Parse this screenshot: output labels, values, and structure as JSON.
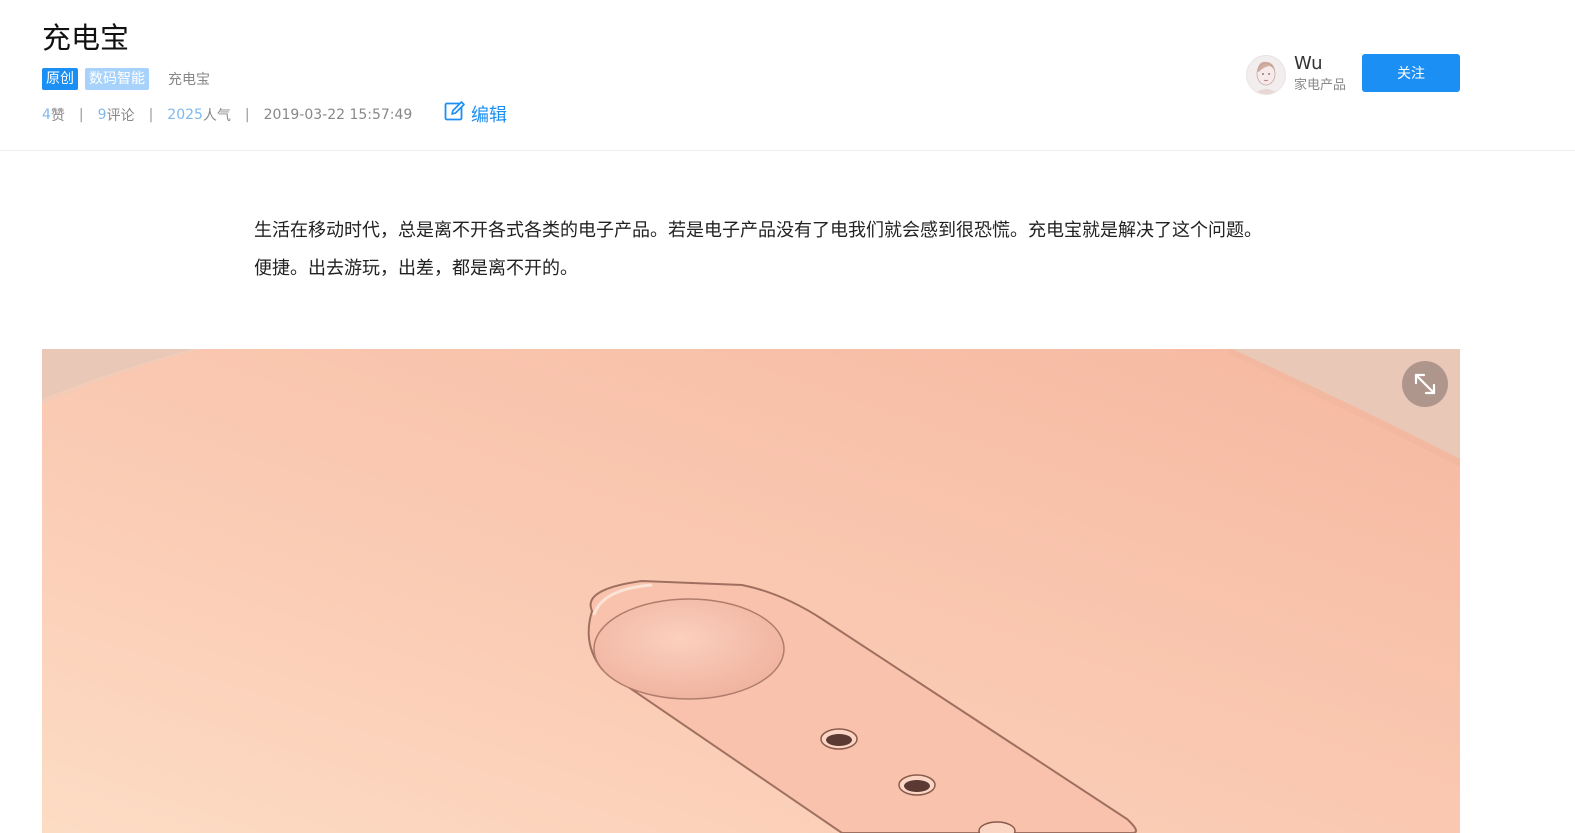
{
  "post": {
    "title": "充电宝",
    "tags": {
      "original": "原创",
      "category": "数码智能",
      "keyword": "充电宝"
    },
    "stats": {
      "likes_count": "4",
      "likes_label": "赞",
      "comments_count": "9",
      "comments_label": "评论",
      "views_count": "2025",
      "views_label": "人气",
      "datetime": "2019-03-22 15:57:49",
      "separator": "|"
    },
    "edit_label": "编辑"
  },
  "author": {
    "name": "Wu",
    "subtitle": "家电产品",
    "follow_label": "关注"
  },
  "content": {
    "paragraph": "生活在移动时代，总是离不开各式各类的电子产品。若是电子产品没有了电我们就会感到很恐慌。充电宝就是解决了这个问题。便捷。出去游玩，出差，都是离不开的。"
  },
  "colors": {
    "accent": "#1c8ff5",
    "tag_light": "#a7d2fb",
    "product": "#f1c2ad"
  },
  "icons": {
    "edit": "edit-icon",
    "expand": "expand-icon",
    "avatar": "avatar"
  }
}
